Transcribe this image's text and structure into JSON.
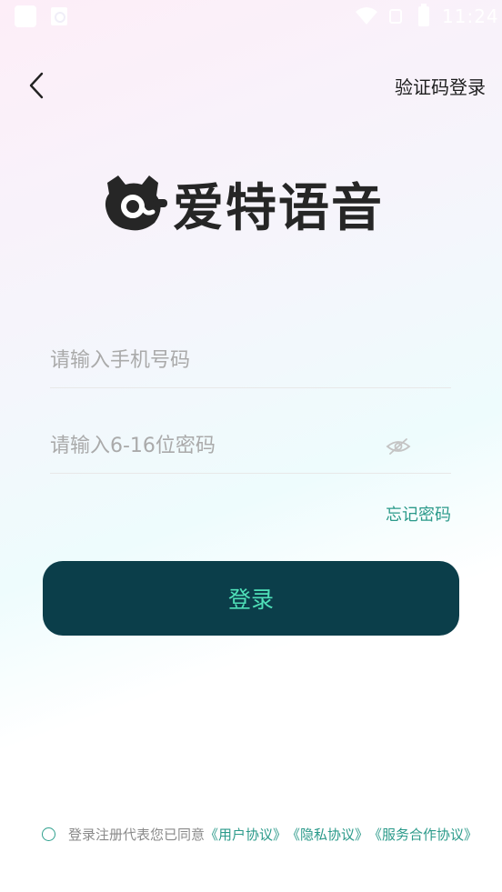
{
  "status_bar": {
    "time": "11:24"
  },
  "header": {
    "sms_login_label": "验证码登录"
  },
  "logo": {
    "text": "爱特语音"
  },
  "form": {
    "phone_placeholder": "请输入手机号码",
    "password_placeholder": "请输入6-16位密码",
    "forgot_label": "忘记密码",
    "login_label": "登录"
  },
  "agreement": {
    "prefix": "登录注册代表您已同意",
    "user_agreement": "《用户协议》",
    "privacy_agreement": "《隐私协议》",
    "service_agreement": "《服务合作协议》"
  },
  "colors": {
    "primary_button": "#0b3e4a",
    "button_text": "#4fe0b8",
    "link": "#2b9a8a"
  }
}
